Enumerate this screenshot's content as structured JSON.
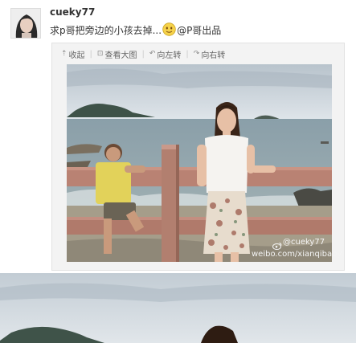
{
  "post": {
    "username": "cueky77",
    "text_before": "求p哥把旁边的小孩去掉...",
    "text_after": "@P哥出品",
    "emoji_icon": "smiley-icon"
  },
  "toolbar": {
    "collect": "收起",
    "view_large": "查看大图",
    "rotate_left": "向左转",
    "rotate_right": "向右转"
  },
  "photo": {
    "watermark_handle": "@cueky77",
    "watermark_url": "weibo.com/xianqibaby"
  },
  "colors": {
    "sky": "#c9d3dc",
    "sea": "#8ea3ad",
    "fence": "#b98273",
    "sand": "#a49c89"
  }
}
